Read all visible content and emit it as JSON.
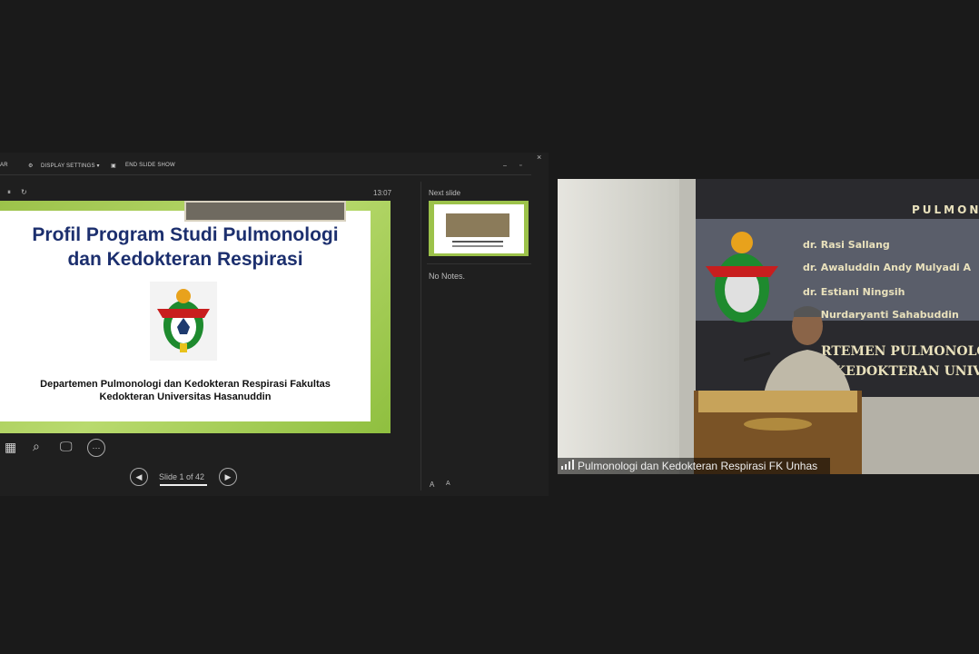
{
  "presenter": {
    "toolbar": {
      "left_fragment": "AR",
      "display_settings": "DISPLAY SETTINGS ▾",
      "end_slide_show": "END SLIDE SHOW"
    },
    "window_controls": {
      "minimize": "–",
      "restore": "▫",
      "close": "×"
    },
    "timer": "13:07",
    "playback": {
      "pause": "⏸",
      "reset": "↻"
    },
    "slide": {
      "title_line1": "Profil Program Studi Pulmonologi",
      "title_line2": "dan Kedokteran Respirasi",
      "subtitle_line1": "Departemen Pulmonologi dan Kedokteran Respirasi Fakultas",
      "subtitle_line2": "Kedokteran Universitas Hasanuddin"
    },
    "next_slide_label": "Next slide",
    "notes": "No Notes.",
    "slide_counter": "Slide 1 of 42",
    "tools": [
      "slides-grid-icon",
      "zoom-icon",
      "screen-icon",
      "more-icon"
    ],
    "font_size": {
      "decrease": "A",
      "increase": "A"
    }
  },
  "video": {
    "caption": "Pulmonologi dan Kedokteran Respirasi FK Unhas",
    "banner": {
      "heading": "PULMON",
      "names": [
        "dr. Rasi Sallang",
        "dr. Awaluddin Andy Mulyadi A",
        "dr. Estiani Ningsih",
        "dr. Nurdaryanti Sahabuddin"
      ],
      "line1": "RTEMEN PULMONOLOGI DA",
      "line2": "KEDOKTERAN UNIVER"
    }
  },
  "colors": {
    "background": "#1a1a1a",
    "slide_accent": "#9cc24a",
    "title": "#1c2f6e"
  }
}
